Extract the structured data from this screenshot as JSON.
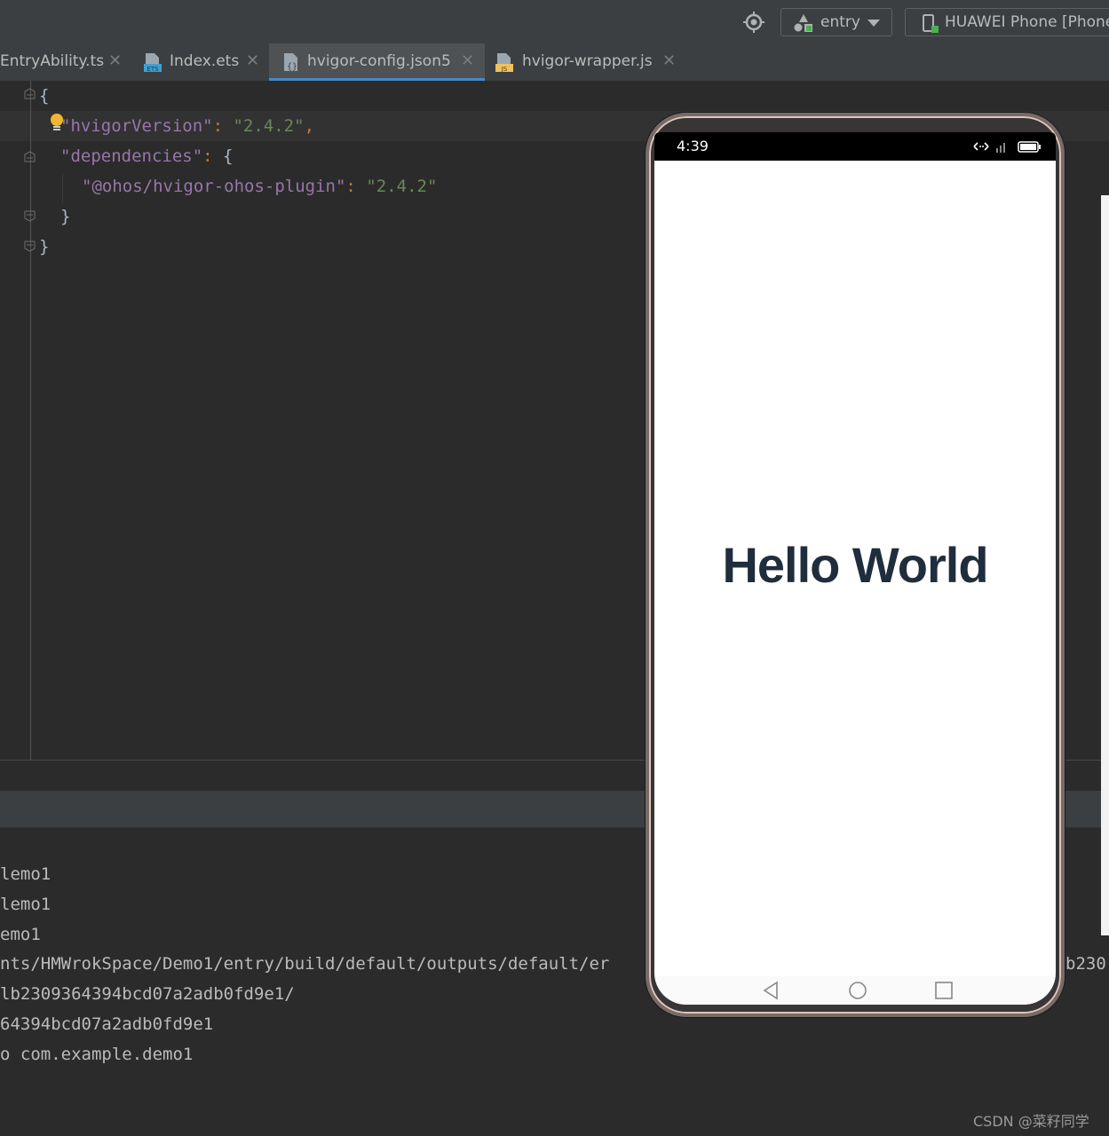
{
  "toolbar": {
    "run_config": "entry",
    "device": "HUAWEI Phone [Phone]"
  },
  "tabs": [
    {
      "label": "EntryAbility.ts",
      "icon": "ts-file-icon",
      "active": false
    },
    {
      "label": "Index.ets",
      "icon": "ets-file-icon",
      "active": false
    },
    {
      "label": "hvigor-config.json5",
      "icon": "json-file-icon",
      "active": true
    },
    {
      "label": "hvigor-wrapper.js",
      "icon": "js-file-icon",
      "active": false
    }
  ],
  "editor": {
    "lines": [
      {
        "open_brace": "{"
      },
      {
        "key": "\"hvigorVersion\"",
        "colon": ": ",
        "value": "\"2.4.2\"",
        "comma": ","
      },
      {
        "key": "\"dependencies\"",
        "colon": ": ",
        "brace": "{"
      },
      {
        "key": "\"@ohos/hvigor-ohos-plugin\"",
        "colon": ": ",
        "value": "\"2.4.2\""
      },
      {
        "close_brace": "}"
      },
      {
        "close_brace": "}"
      }
    ]
  },
  "console": {
    "lines": [
      "lemo1",
      "lemo1",
      "emo1",
      "nts/HMWrokSpace/Demo1/entry/build/default/outputs/default/er",
      "lb2309364394bcd07a2adb0fd9e1/",
      "64394bcd07a2adb0fd9e1",
      "o com.example.demo1"
    ],
    "right_fragment": "b230"
  },
  "phone": {
    "status_time": "4:39",
    "content_text": "Hello World"
  },
  "watermark": "CSDN @菜籽同学",
  "colors": {
    "keyword": "#9876aa",
    "string": "#6a8759",
    "punctuation": "#a9b7c6",
    "accent": "#4a88c7"
  }
}
